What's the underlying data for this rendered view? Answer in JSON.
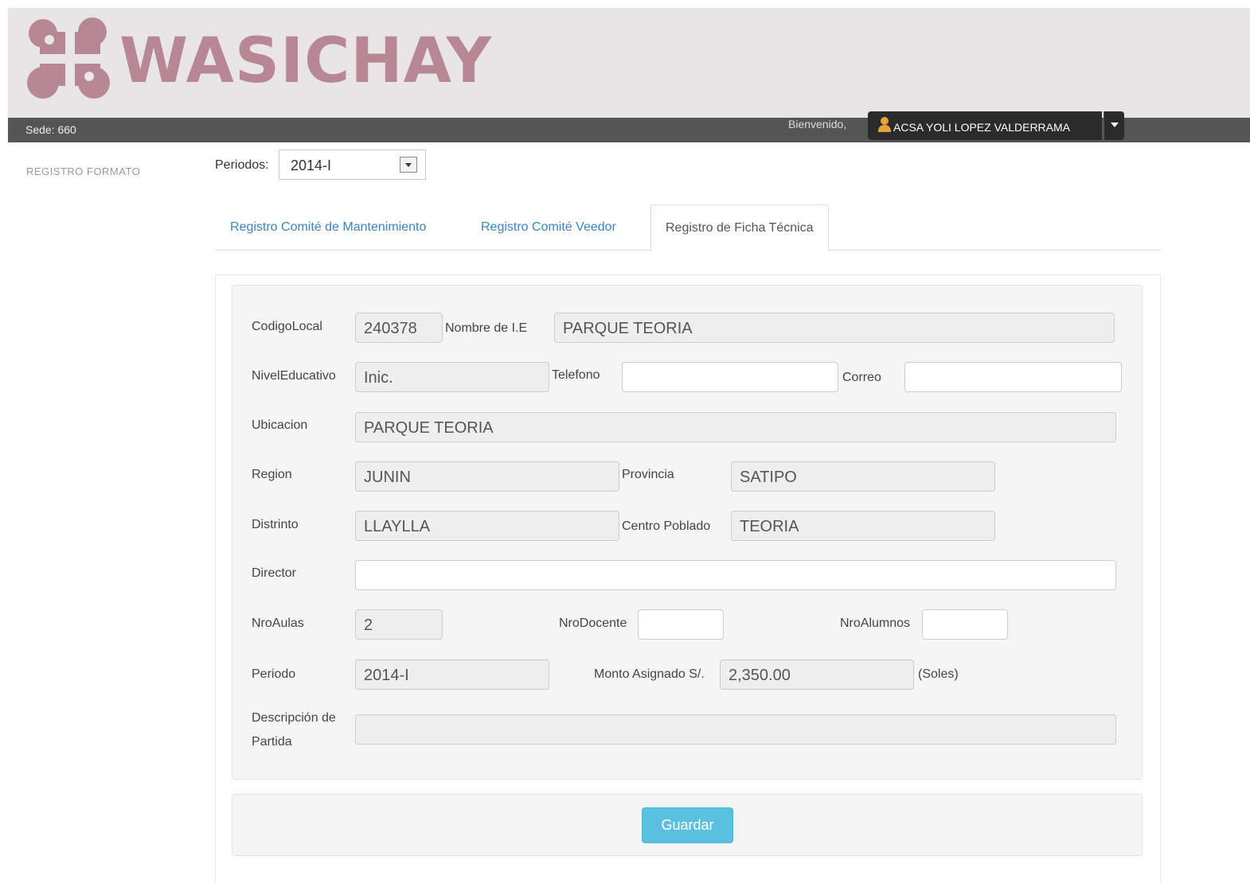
{
  "brand": {
    "name": "WASICHAY",
    "logo_icon": "cross-puzzle-logo-icon"
  },
  "topbar": {
    "sede": "Sede: 660",
    "welcome": "Bienvenido,",
    "user_name": "ACSA YOLI LOPEZ VALDERRAMA",
    "user_icon": "user-icon"
  },
  "sidebar": {
    "item": "REGISTRO FORMATO"
  },
  "period_selector": {
    "label": "Periodos:",
    "value": "2014-I"
  },
  "tabs": [
    {
      "label": "Registro Comité de Mantenimiento",
      "active": false
    },
    {
      "label": "Registro Comité Veedor",
      "active": false
    },
    {
      "label": "Registro de Ficha Técnica",
      "active": true
    }
  ],
  "form": {
    "codigo_local": {
      "label": "CodigoLocal",
      "value": "240378"
    },
    "nombre_ie": {
      "label": "Nombre de I.E",
      "value": "PARQUE TEORIA"
    },
    "nivel_educativo": {
      "label": "NivelEducativo",
      "value": "Inic."
    },
    "telefono": {
      "label": "Telefono",
      "value": ""
    },
    "correo": {
      "label": "Correo",
      "value": ""
    },
    "ubicacion": {
      "label": "Ubicacion",
      "value": "PARQUE TEORIA"
    },
    "region": {
      "label": "Region",
      "value": "JUNIN"
    },
    "provincia": {
      "label": "Provincia",
      "value": "SATIPO"
    },
    "distrito": {
      "label": "Distrinto",
      "value": "LLAYLLA"
    },
    "centro_poblado": {
      "label": "Centro Poblado",
      "value": "TEORIA"
    },
    "director": {
      "label": "Director",
      "value": ""
    },
    "nro_aulas": {
      "label": "NroAulas",
      "value": "2"
    },
    "nro_docente": {
      "label": "NroDocente",
      "value": ""
    },
    "nro_alumnos": {
      "label": "NroAlumnos",
      "value": ""
    },
    "periodo": {
      "label": "Periodo",
      "value": "2014-I"
    },
    "monto": {
      "label": "Monto Asignado S/.",
      "value": "2,350.00",
      "unit": "(Soles)"
    },
    "descripcion": {
      "label_line1": "Descripción de",
      "label_line2": "Partida",
      "value": ""
    }
  },
  "actions": {
    "save_label": "Guardar"
  },
  "colors": {
    "logo": "#b78795",
    "header_bg": "#e9e5e6",
    "topbar_bg": "#555555",
    "tab_link": "#3a84c4",
    "save_button": "#5bc0de"
  }
}
